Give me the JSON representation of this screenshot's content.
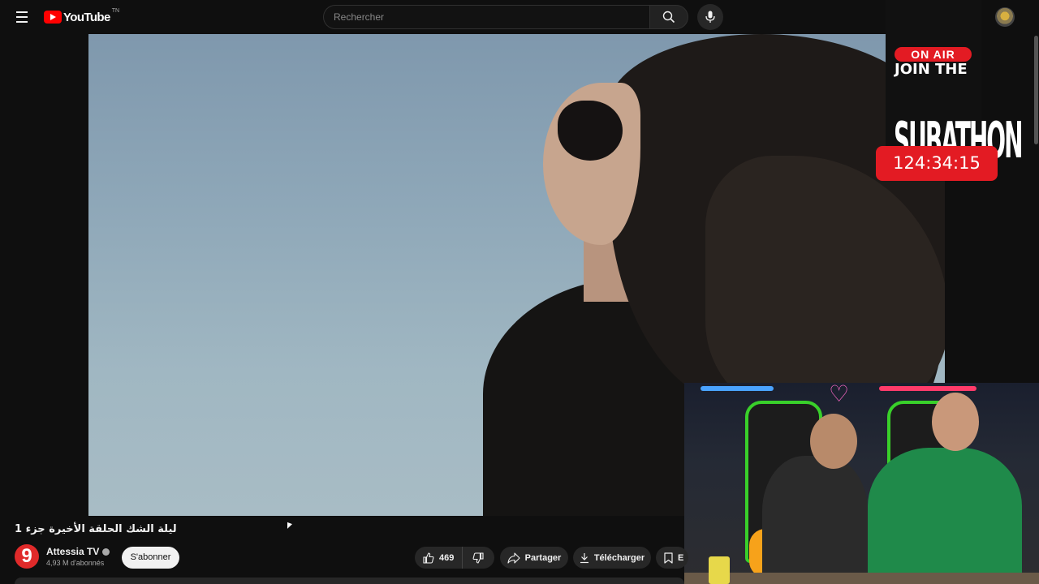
{
  "header": {
    "logo_text": "YouTube",
    "region_code": "TN",
    "search": {
      "placeholder": "Rechercher",
      "value": ""
    }
  },
  "overlay": {
    "onair_label": "ON AIR",
    "join_label": "JOIN THE",
    "subathon_label": "SUBATHON",
    "timer": "124:34:15"
  },
  "video": {
    "title": "ليلة الشك الحلقة الأخيرة جزء 1"
  },
  "channel": {
    "avatar_text": "9",
    "name": "Attessia TV",
    "subscribers": "4,93 M d'abonnés",
    "subscribe_label": "S'abonner"
  },
  "actions": {
    "likes": "469",
    "share_label": "Partager",
    "download_label": "Télécharger",
    "save_label": "E"
  },
  "colors": {
    "brand_red": "#ff0000",
    "overlay_red": "#e31b23",
    "background": "#0f0f0f"
  }
}
